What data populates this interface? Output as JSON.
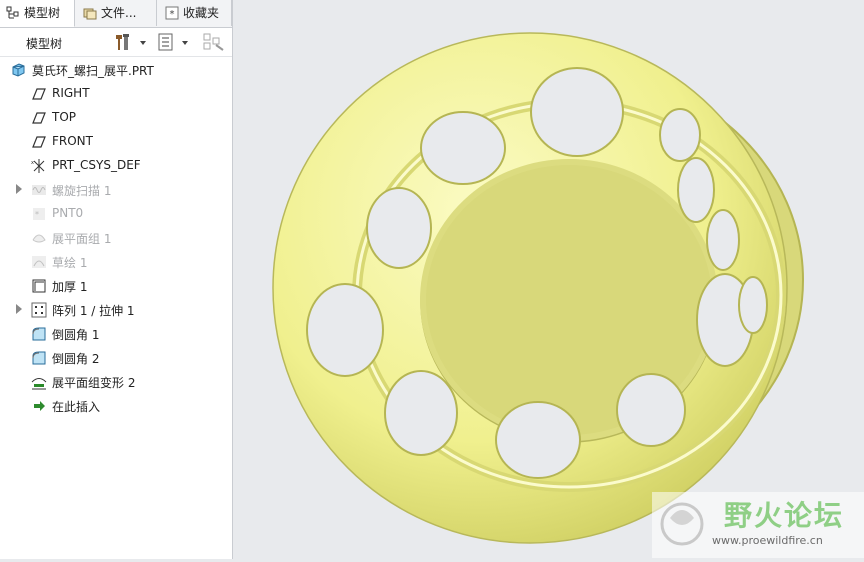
{
  "tabs": [
    {
      "label": "模型树",
      "icon": "model-tree-icon"
    },
    {
      "label": "文件...",
      "icon": "folder-browser-icon"
    },
    {
      "label": "收藏夹",
      "icon": "favorites-icon"
    }
  ],
  "toolbar": {
    "title": "模型树"
  },
  "tree": {
    "root": "莫氏环_螺扫_展平.PRT",
    "items": [
      {
        "label": "RIGHT",
        "icon": "datum-plane-icon",
        "dim": false,
        "expandable": false
      },
      {
        "label": "TOP",
        "icon": "datum-plane-icon",
        "dim": false,
        "expandable": false
      },
      {
        "label": "FRONT",
        "icon": "datum-plane-icon",
        "dim": false,
        "expandable": false
      },
      {
        "label": "PRT_CSYS_DEF",
        "icon": "coordinate-system-icon",
        "dim": false,
        "expandable": false
      },
      {
        "label": "螺旋扫描 1",
        "icon": "helical-sweep-icon",
        "dim": true,
        "expandable": true
      },
      {
        "label": "PNT0",
        "icon": "datum-point-icon",
        "dim": true,
        "expandable": false
      },
      {
        "label": "展平面组 1",
        "icon": "flatten-quilt-icon",
        "dim": true,
        "expandable": false
      },
      {
        "label": "草绘 1",
        "icon": "sketch-icon",
        "dim": true,
        "expandable": false
      },
      {
        "label": "加厚 1",
        "icon": "thicken-icon",
        "dim": false,
        "expandable": false
      },
      {
        "label": "阵列 1 / 拉伸 1",
        "icon": "pattern-icon",
        "dim": false,
        "expandable": true
      },
      {
        "label": "倒圆角 1",
        "icon": "round-icon",
        "dim": false,
        "expandable": false
      },
      {
        "label": "倒圆角 2",
        "icon": "round-icon",
        "dim": false,
        "expandable": false
      },
      {
        "label": "展平面组变形 2",
        "icon": "flatten-deform-icon",
        "dim": false,
        "expandable": false
      },
      {
        "label": "在此插入",
        "icon": "insert-here-arrow-icon",
        "dim": false,
        "expandable": false
      }
    ]
  },
  "watermark": {
    "title": "野火论坛",
    "url": "www.proewildfire.cn"
  },
  "colors": {
    "model": "#f3f39a",
    "background": "#e8eaed",
    "insert_arrow": "#2e8b2e"
  }
}
